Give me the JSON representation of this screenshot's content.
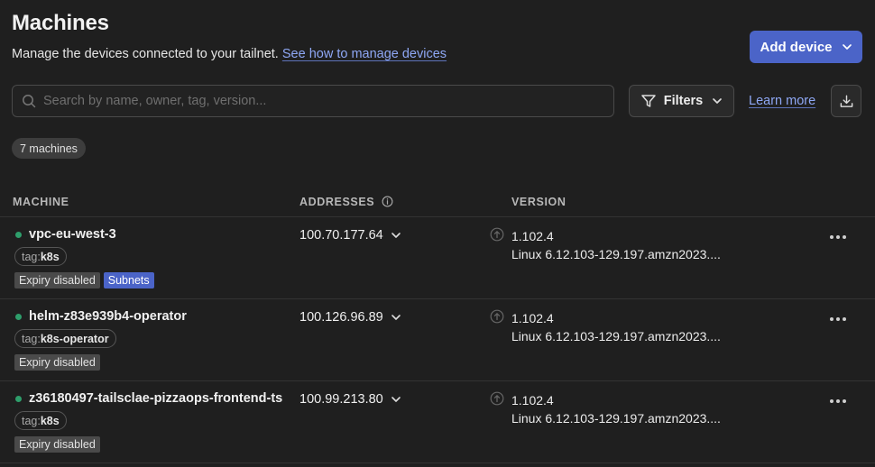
{
  "header": {
    "title": "Machines",
    "subtitle": "Manage the devices connected to your tailnet.",
    "subtitle_link": "See how to manage devices",
    "add_device_label": "Add device"
  },
  "toolbar": {
    "search_placeholder": "Search by name, owner, tag, version...",
    "search_value": "",
    "filters_label": "Filters",
    "learn_more_label": "Learn more"
  },
  "machine_count": "7 machines",
  "table": {
    "columns": [
      "MACHINE",
      "ADDRESSES",
      "VERSION"
    ],
    "rows": [
      {
        "name": "vpc-eu-west-3",
        "tag_prefix": "tag:",
        "tag": "k8s",
        "badges": [
          "Expiry disabled",
          "Subnets"
        ],
        "address": "100.70.177.64",
        "version": "1.102.4",
        "os": "Linux 6.12.103-129.197.amzn2023...."
      },
      {
        "name": "helm-z83e939b4-operator",
        "tag_prefix": "tag:",
        "tag": "k8s-operator",
        "badges": [
          "Expiry disabled"
        ],
        "address": "100.126.96.89",
        "version": "1.102.4",
        "os": "Linux 6.12.103-129.197.amzn2023...."
      },
      {
        "name": "z36180497-tailsclae-pizzaops-frontend-ts",
        "tag_prefix": "tag:",
        "tag": "k8s",
        "badges": [
          "Expiry disabled"
        ],
        "address": "100.99.213.80",
        "version": "1.102.4",
        "os": "Linux 6.12.103-129.197.amzn2023...."
      }
    ]
  },
  "colors": {
    "background": "#1f1f1f",
    "accent": "#4b64c8",
    "link": "#8fa8f5",
    "online": "#2e9e6b"
  },
  "icons": [
    "chevron-down-icon",
    "search-icon",
    "filter-icon",
    "download-icon",
    "info-icon",
    "update-arrow-icon",
    "more-icon",
    "status-dot"
  ]
}
